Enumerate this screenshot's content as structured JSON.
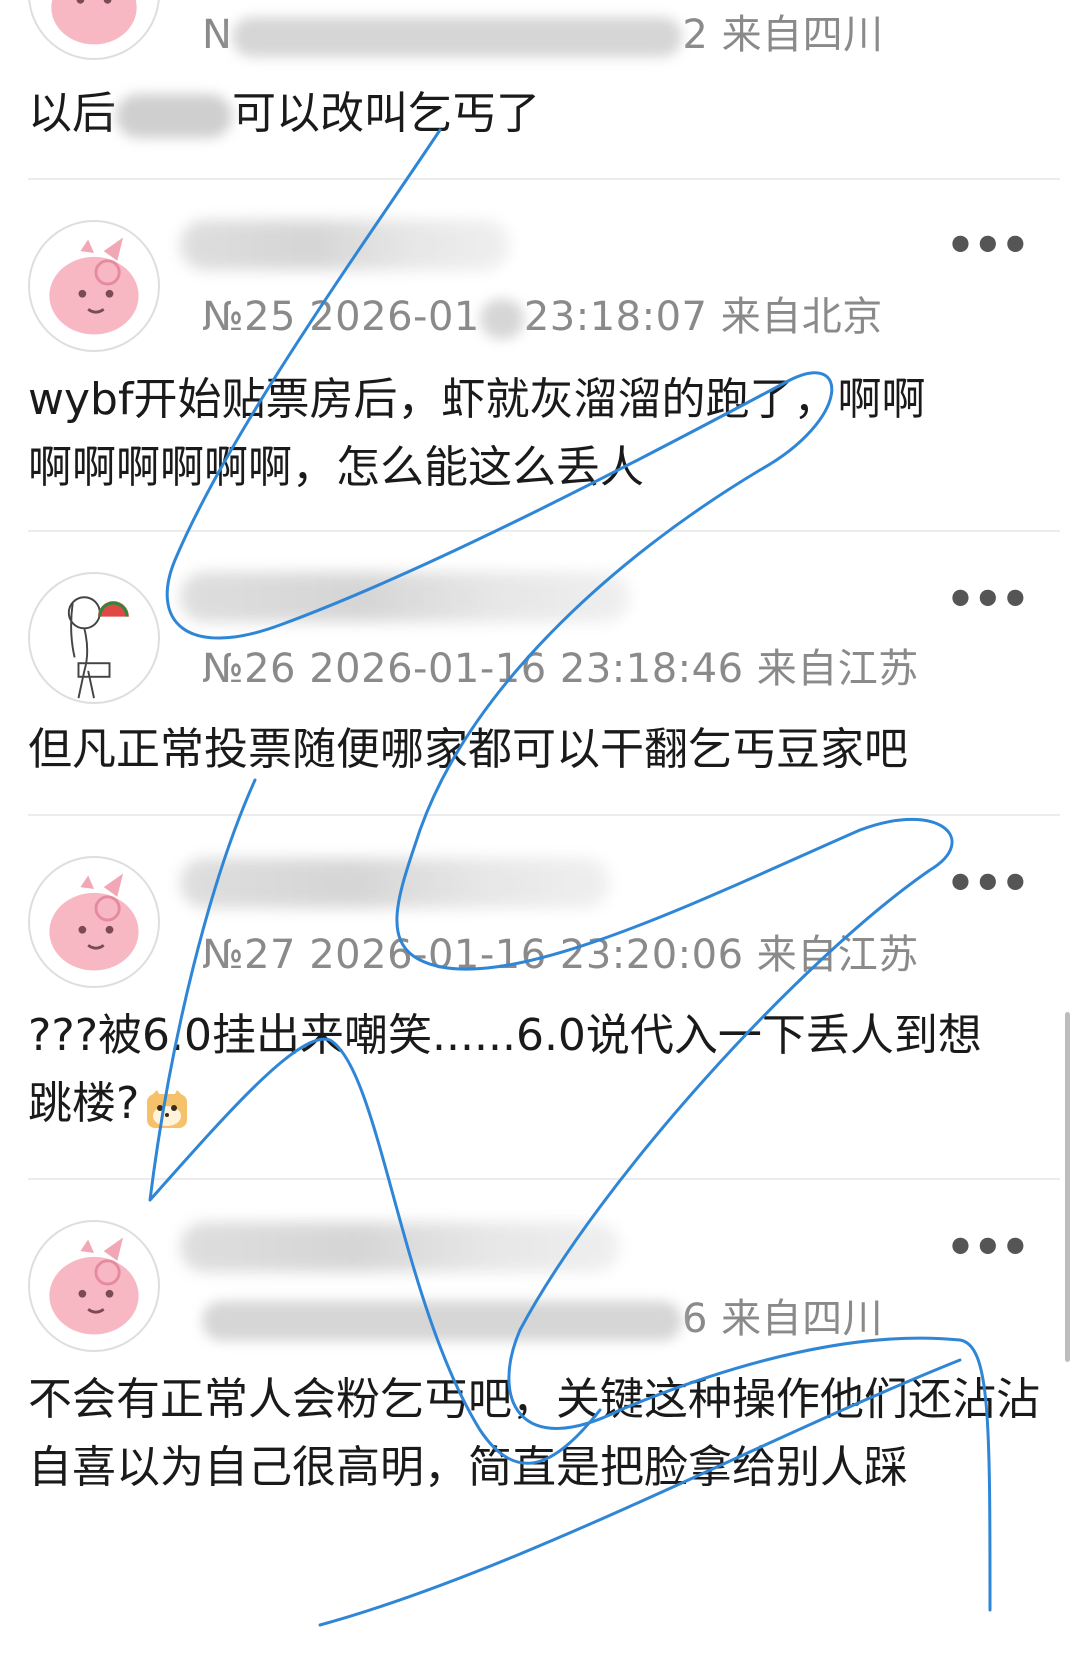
{
  "comments": [
    {
      "number": "",
      "date_time": "2",
      "location": "来自四川",
      "text_before": "以后",
      "text_after": "可以改叫乞丐了"
    },
    {
      "number": "№25",
      "date_time": "2026-01",
      "date_time_2": "23:18:07",
      "location": "来自北京",
      "text": "wybf开始贴票房后，虾就灰溜溜的跑了，啊啊啊啊啊啊啊啊，怎么能这么丢人"
    },
    {
      "number": "№26",
      "date_time": "2026-01-16 23:18:46",
      "location": "来自江苏",
      "text": "但凡正常投票随便哪家都可以干翻乞丐豆家吧"
    },
    {
      "number": "№27",
      "date_time": "2026-01-16 23:20:06",
      "location": "来自江苏",
      "text": "???被6.0挂出来嘲笑......6.0说代入一下丢人到想跳楼?"
    },
    {
      "number": "",
      "date_time": "6",
      "location": "来自四川",
      "text": "不会有正常人会粉乞丐吧，关键这种操作他们还沾沾自喜以为自己很高明，简直是把脸拿给别人踩"
    }
  ],
  "more_icon_glyph": "•••",
  "colors": {
    "accent_scribble": "#2f86d6",
    "meta": "#8a8a8a",
    "divider": "#ececec"
  }
}
